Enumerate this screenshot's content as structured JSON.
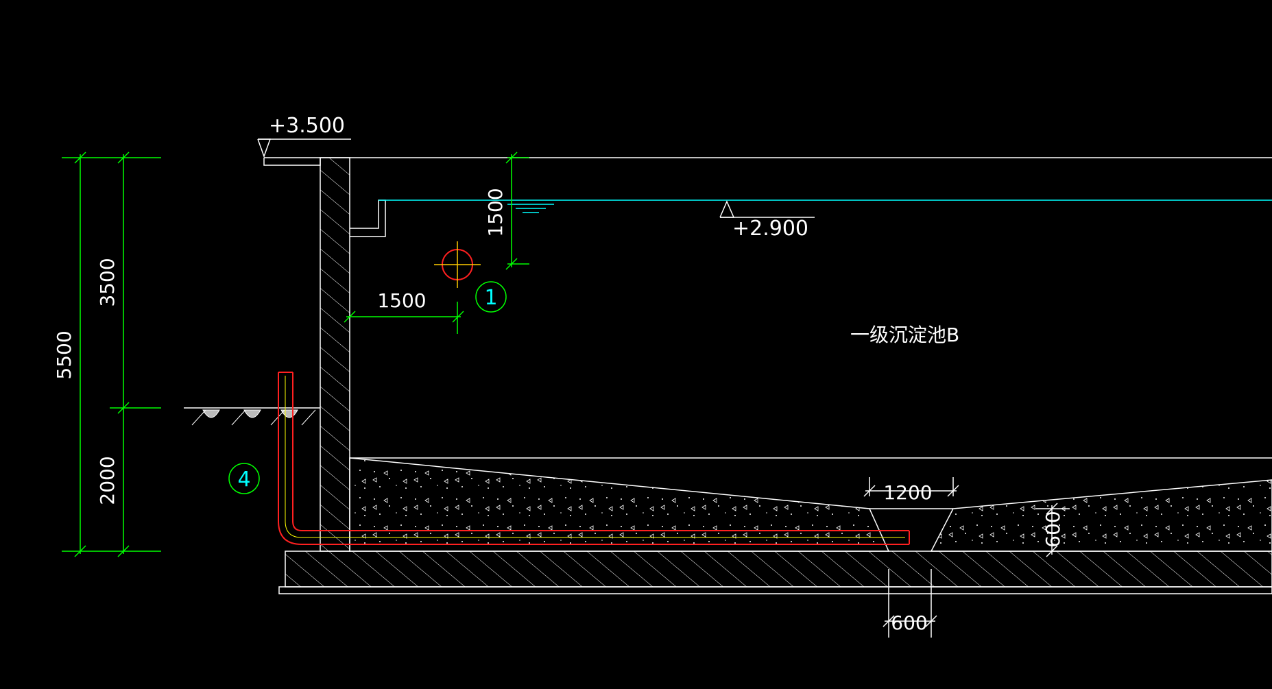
{
  "colors": {
    "background": "#000000",
    "structure": "#ffffff",
    "dimension": "#00ff00",
    "water_line": "#00ffff",
    "pipe": "#ff2020",
    "pipe_core": "#ffff00",
    "center_mark_circle": "#ff2020",
    "center_mark_cross": "#ffcc00",
    "callout_circle": "#00ff00",
    "callout_text": "#00ffff"
  },
  "elevations": {
    "top": "+3.500",
    "water": "+2.900"
  },
  "dimensions": {
    "total_height": "5500",
    "upper_height": "3500",
    "lower_height": "2000",
    "freeboard": "1500",
    "wall_offset": "1500",
    "trench_width": "1200",
    "trench_depth": "600",
    "sump_width": "600"
  },
  "labels": {
    "tank_name": "一级沉淀池B"
  },
  "callouts": {
    "detail_1": "1",
    "detail_4": "4"
  }
}
